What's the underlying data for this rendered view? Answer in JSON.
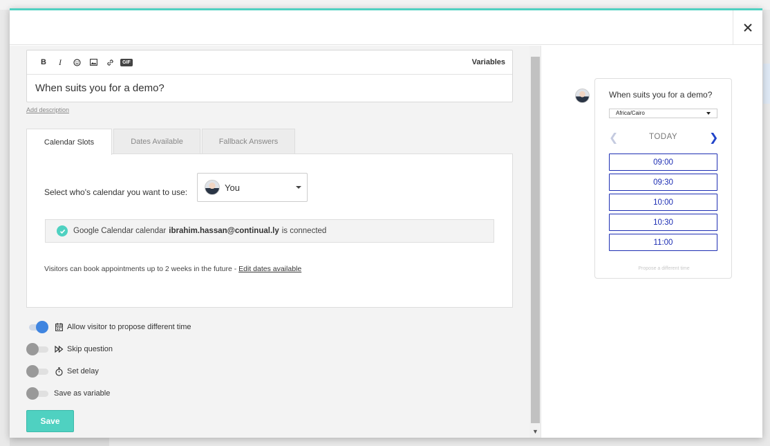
{
  "editor": {
    "toolbar": {
      "bold_label": "B",
      "italic_label": "I",
      "gif_label": "GIF",
      "variables_label": "Variables"
    },
    "question": "When suits you for a demo?",
    "add_description": "Add description"
  },
  "tabs": [
    {
      "label": "Calendar Slots",
      "active": true
    },
    {
      "label": "Dates Available",
      "active": false
    },
    {
      "label": "Fallback Answers",
      "active": false
    }
  ],
  "calendar_slots": {
    "select_label": "Select who's calendar you want to use:",
    "selected_user": "You",
    "connection": {
      "prefix": "Google Calendar calendar",
      "email": "ibrahim.hassan@continual.ly",
      "suffix": "is connected"
    },
    "booking_note": "Visitors can book appointments up to 2 weeks in the future - ",
    "edit_dates_link": "Edit dates available"
  },
  "toggles": [
    {
      "label": "Allow visitor to propose different time",
      "on": true,
      "icon": "calendar-icon"
    },
    {
      "label": "Skip question",
      "on": false,
      "icon": "fast-forward-icon"
    },
    {
      "label": "Set delay",
      "on": false,
      "icon": "stopwatch-icon"
    },
    {
      "label": "Save as variable",
      "on": false,
      "icon": ""
    }
  ],
  "save_label": "Save",
  "preview": {
    "question": "When suits you for a demo?",
    "timezone": "Africa/Cairo",
    "day_label": "TODAY",
    "slots": [
      "09:00",
      "09:30",
      "10:00",
      "10:30",
      "11:00"
    ],
    "propose_label": "Propose a different time"
  },
  "colors": {
    "accent": "#4fd1c1",
    "toggle_on": "#3f85e0",
    "slot_border": "#1c2db3"
  }
}
